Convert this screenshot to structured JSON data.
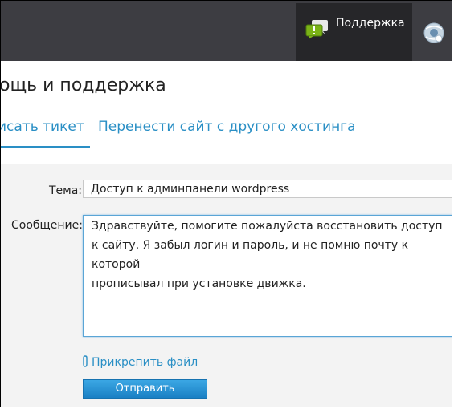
{
  "header": {
    "support_tab_label": "Поддержка",
    "support_icon": "chat-bubble-icon",
    "globe_icon": "globe-icon"
  },
  "page": {
    "title": "ощь и поддержка"
  },
  "tabs": [
    {
      "label": "исать тикет",
      "active": true
    },
    {
      "label": "Перенести сайт с другого хостинга",
      "active": false
    }
  ],
  "form": {
    "subject_label": "Тема:",
    "subject_value": "Доступ к админпанели wordpress",
    "message_label": "Сообщение:",
    "message_value": "Здравствуйте, помогите пожалуйста восстановить доступ\nк сайту. Я забыл логин и пароль, и не помню почту к которой\nпрописывал при установке движка.",
    "attach_label": "Прикрепить файл",
    "submit_label": "Отправить"
  },
  "colors": {
    "accent": "#2a8fc5",
    "header_bg": "#3d3d42",
    "active_tab_bg": "#262629"
  }
}
